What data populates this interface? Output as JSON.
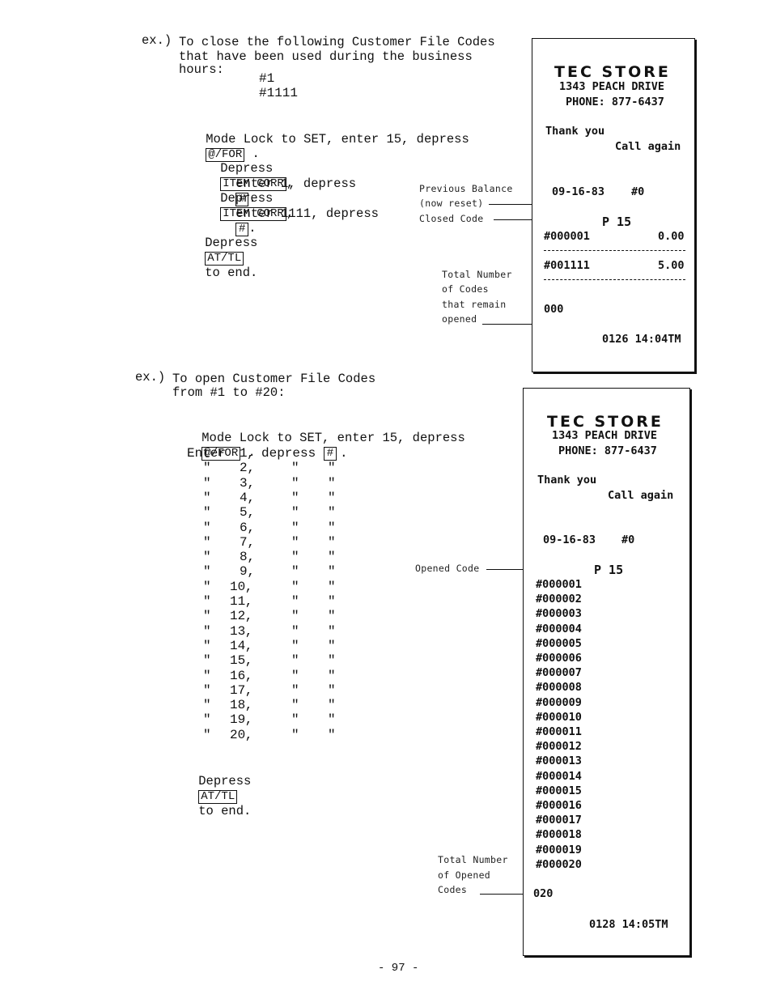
{
  "page_number": "- 97 -",
  "example1": {
    "prefix": "ex.)",
    "intro_lines": [
      "To close the following Customer File Codes",
      "that have been used during the business",
      "hours:"
    ],
    "codes": [
      "#1",
      "#1111"
    ],
    "mode_lock_text": "Mode Lock to SET, enter 15, depress",
    "mode_lock_key": "@/FOR",
    "steps": [
      {
        "prefix": "Depress",
        "key": "ITEM CORR",
        "suffix": ","
      },
      {
        "prefix": "enter 1, depress",
        "key": "#",
        "suffix": "."
      },
      {
        "prefix": "Depress",
        "key": "ITEM CORR",
        "suffix": ","
      },
      {
        "prefix": "enter 1111, depress",
        "key": "#",
        "suffix": "."
      }
    ],
    "end_prefix": "Depress",
    "end_key": "AT/TL",
    "end_suffix": "to end.",
    "annotations": {
      "previous_balance": [
        "Previous Balance",
        "(now reset)"
      ],
      "closed_code": "Closed Code",
      "total_remaining": [
        "Total Number",
        "of Codes",
        "that remain",
        "opened"
      ]
    },
    "receipt": {
      "store_name": "TEC STORE",
      "address": "1343 PEACH DRIVE",
      "phone": "PHONE: 877-6437",
      "thank_you": "Thank you",
      "call_again": "Call again",
      "date": "09-16-83",
      "number": "#0",
      "mode": "P 15",
      "rows": [
        {
          "code": "#000001",
          "amount": "0.00"
        },
        {
          "code": "#001111",
          "amount": "5.00"
        }
      ],
      "count": "000",
      "footer": "0126 14:04TM"
    }
  },
  "example2": {
    "prefix": "ex.)",
    "intro_lines": [
      "To open Customer File Codes",
      "from #1 to #20:"
    ],
    "mode_lock_text": "Mode Lock to SET, enter 15, depress",
    "mode_lock_key": "@/FOR",
    "enter_label": "Enter",
    "depress_label": "depress",
    "key": "#",
    "ditto": "\"",
    "numbers": [
      "1",
      "2",
      "3",
      "4",
      "5",
      "6",
      "7",
      "8",
      "9",
      "10",
      "11",
      "12",
      "13",
      "14",
      "15",
      "16",
      "17",
      "18",
      "19",
      "20"
    ],
    "end_prefix": "Depress",
    "end_key": "AT/TL",
    "end_suffix": "to end.",
    "annotations": {
      "opened_code": "Opened Code",
      "total_opened": [
        "Total Number",
        "of Opened",
        "Codes"
      ]
    },
    "receipt": {
      "store_name": "TEC STORE",
      "address": "1343 PEACH DRIVE",
      "phone": "PHONE: 877-6437",
      "thank_you": "Thank you",
      "call_again": "Call again",
      "date": "09-16-83",
      "number": "#0",
      "mode": "P 15",
      "codes": [
        "#000001",
        "#000002",
        "#000003",
        "#000004",
        "#000005",
        "#000006",
        "#000007",
        "#000008",
        "#000009",
        "#000010",
        "#000011",
        "#000012",
        "#000013",
        "#000014",
        "#000015",
        "#000016",
        "#000017",
        "#000018",
        "#000019",
        "#000020"
      ],
      "count": "020",
      "footer": "0128 14:05TM"
    }
  }
}
